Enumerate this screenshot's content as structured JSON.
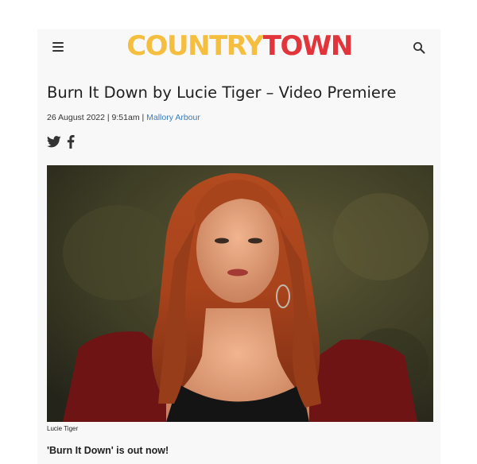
{
  "header": {
    "logo_part1": "COUNTRY",
    "logo_part2": "TOWN",
    "menu_icon": "hamburger-menu-icon",
    "search_icon": "search-icon",
    "colors": {
      "logo_yellow": "#f6be3e",
      "logo_red": "#e2343b"
    }
  },
  "article": {
    "title": "Burn It Down by Lucie Tiger – Video Premiere",
    "date": "26 August 2022 | 9:51am |",
    "author": "Mallory Arbour",
    "author_color": "#3a7bbf",
    "share_icons": [
      "twitter-icon",
      "facebook-icon"
    ],
    "image_caption": "Lucie Tiger",
    "lead_text": "'Burn It Down' is out now!"
  }
}
